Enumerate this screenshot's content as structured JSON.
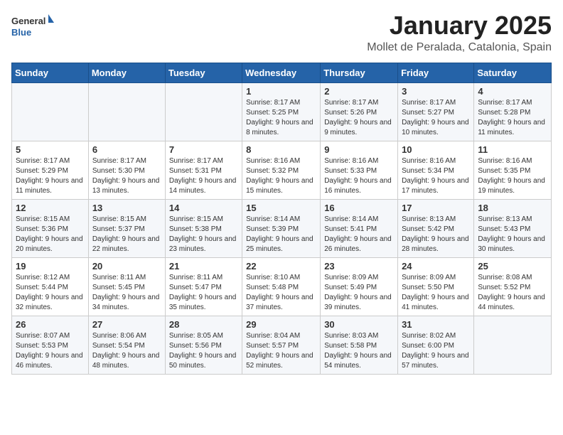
{
  "header": {
    "logo_general": "General",
    "logo_blue": "Blue",
    "title": "January 2025",
    "subtitle": "Mollet de Peralada, Catalonia, Spain"
  },
  "weekdays": [
    "Sunday",
    "Monday",
    "Tuesday",
    "Wednesday",
    "Thursday",
    "Friday",
    "Saturday"
  ],
  "weeks": [
    [
      {
        "day": "",
        "sunrise": "",
        "sunset": "",
        "daylight": ""
      },
      {
        "day": "",
        "sunrise": "",
        "sunset": "",
        "daylight": ""
      },
      {
        "day": "",
        "sunrise": "",
        "sunset": "",
        "daylight": ""
      },
      {
        "day": "1",
        "sunrise": "Sunrise: 8:17 AM",
        "sunset": "Sunset: 5:25 PM",
        "daylight": "Daylight: 9 hours and 8 minutes."
      },
      {
        "day": "2",
        "sunrise": "Sunrise: 8:17 AM",
        "sunset": "Sunset: 5:26 PM",
        "daylight": "Daylight: 9 hours and 9 minutes."
      },
      {
        "day": "3",
        "sunrise": "Sunrise: 8:17 AM",
        "sunset": "Sunset: 5:27 PM",
        "daylight": "Daylight: 9 hours and 10 minutes."
      },
      {
        "day": "4",
        "sunrise": "Sunrise: 8:17 AM",
        "sunset": "Sunset: 5:28 PM",
        "daylight": "Daylight: 9 hours and 11 minutes."
      }
    ],
    [
      {
        "day": "5",
        "sunrise": "Sunrise: 8:17 AM",
        "sunset": "Sunset: 5:29 PM",
        "daylight": "Daylight: 9 hours and 11 minutes."
      },
      {
        "day": "6",
        "sunrise": "Sunrise: 8:17 AM",
        "sunset": "Sunset: 5:30 PM",
        "daylight": "Daylight: 9 hours and 13 minutes."
      },
      {
        "day": "7",
        "sunrise": "Sunrise: 8:17 AM",
        "sunset": "Sunset: 5:31 PM",
        "daylight": "Daylight: 9 hours and 14 minutes."
      },
      {
        "day": "8",
        "sunrise": "Sunrise: 8:16 AM",
        "sunset": "Sunset: 5:32 PM",
        "daylight": "Daylight: 9 hours and 15 minutes."
      },
      {
        "day": "9",
        "sunrise": "Sunrise: 8:16 AM",
        "sunset": "Sunset: 5:33 PM",
        "daylight": "Daylight: 9 hours and 16 minutes."
      },
      {
        "day": "10",
        "sunrise": "Sunrise: 8:16 AM",
        "sunset": "Sunset: 5:34 PM",
        "daylight": "Daylight: 9 hours and 17 minutes."
      },
      {
        "day": "11",
        "sunrise": "Sunrise: 8:16 AM",
        "sunset": "Sunset: 5:35 PM",
        "daylight": "Daylight: 9 hours and 19 minutes."
      }
    ],
    [
      {
        "day": "12",
        "sunrise": "Sunrise: 8:15 AM",
        "sunset": "Sunset: 5:36 PM",
        "daylight": "Daylight: 9 hours and 20 minutes."
      },
      {
        "day": "13",
        "sunrise": "Sunrise: 8:15 AM",
        "sunset": "Sunset: 5:37 PM",
        "daylight": "Daylight: 9 hours and 22 minutes."
      },
      {
        "day": "14",
        "sunrise": "Sunrise: 8:15 AM",
        "sunset": "Sunset: 5:38 PM",
        "daylight": "Daylight: 9 hours and 23 minutes."
      },
      {
        "day": "15",
        "sunrise": "Sunrise: 8:14 AM",
        "sunset": "Sunset: 5:39 PM",
        "daylight": "Daylight: 9 hours and 25 minutes."
      },
      {
        "day": "16",
        "sunrise": "Sunrise: 8:14 AM",
        "sunset": "Sunset: 5:41 PM",
        "daylight": "Daylight: 9 hours and 26 minutes."
      },
      {
        "day": "17",
        "sunrise": "Sunrise: 8:13 AM",
        "sunset": "Sunset: 5:42 PM",
        "daylight": "Daylight: 9 hours and 28 minutes."
      },
      {
        "day": "18",
        "sunrise": "Sunrise: 8:13 AM",
        "sunset": "Sunset: 5:43 PM",
        "daylight": "Daylight: 9 hours and 30 minutes."
      }
    ],
    [
      {
        "day": "19",
        "sunrise": "Sunrise: 8:12 AM",
        "sunset": "Sunset: 5:44 PM",
        "daylight": "Daylight: 9 hours and 32 minutes."
      },
      {
        "day": "20",
        "sunrise": "Sunrise: 8:11 AM",
        "sunset": "Sunset: 5:45 PM",
        "daylight": "Daylight: 9 hours and 34 minutes."
      },
      {
        "day": "21",
        "sunrise": "Sunrise: 8:11 AM",
        "sunset": "Sunset: 5:47 PM",
        "daylight": "Daylight: 9 hours and 35 minutes."
      },
      {
        "day": "22",
        "sunrise": "Sunrise: 8:10 AM",
        "sunset": "Sunset: 5:48 PM",
        "daylight": "Daylight: 9 hours and 37 minutes."
      },
      {
        "day": "23",
        "sunrise": "Sunrise: 8:09 AM",
        "sunset": "Sunset: 5:49 PM",
        "daylight": "Daylight: 9 hours and 39 minutes."
      },
      {
        "day": "24",
        "sunrise": "Sunrise: 8:09 AM",
        "sunset": "Sunset: 5:50 PM",
        "daylight": "Daylight: 9 hours and 41 minutes."
      },
      {
        "day": "25",
        "sunrise": "Sunrise: 8:08 AM",
        "sunset": "Sunset: 5:52 PM",
        "daylight": "Daylight: 9 hours and 44 minutes."
      }
    ],
    [
      {
        "day": "26",
        "sunrise": "Sunrise: 8:07 AM",
        "sunset": "Sunset: 5:53 PM",
        "daylight": "Daylight: 9 hours and 46 minutes."
      },
      {
        "day": "27",
        "sunrise": "Sunrise: 8:06 AM",
        "sunset": "Sunset: 5:54 PM",
        "daylight": "Daylight: 9 hours and 48 minutes."
      },
      {
        "day": "28",
        "sunrise": "Sunrise: 8:05 AM",
        "sunset": "Sunset: 5:56 PM",
        "daylight": "Daylight: 9 hours and 50 minutes."
      },
      {
        "day": "29",
        "sunrise": "Sunrise: 8:04 AM",
        "sunset": "Sunset: 5:57 PM",
        "daylight": "Daylight: 9 hours and 52 minutes."
      },
      {
        "day": "30",
        "sunrise": "Sunrise: 8:03 AM",
        "sunset": "Sunset: 5:58 PM",
        "daylight": "Daylight: 9 hours and 54 minutes."
      },
      {
        "day": "31",
        "sunrise": "Sunrise: 8:02 AM",
        "sunset": "Sunset: 6:00 PM",
        "daylight": "Daylight: 9 hours and 57 minutes."
      },
      {
        "day": "",
        "sunrise": "",
        "sunset": "",
        "daylight": ""
      }
    ]
  ]
}
